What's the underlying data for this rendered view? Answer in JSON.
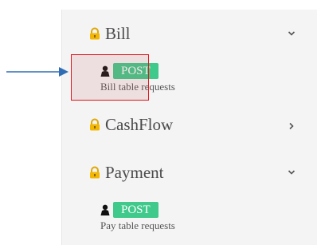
{
  "sections": [
    {
      "title": "Bill",
      "expanded": true,
      "endpoints": [
        {
          "method": "POST",
          "description": "Bill table requests"
        }
      ]
    },
    {
      "title": "CashFlow",
      "expanded": false,
      "endpoints": []
    },
    {
      "title": "Payment",
      "expanded": true,
      "endpoints": [
        {
          "method": "POST",
          "description": "Pay table requests"
        }
      ]
    }
  ],
  "colors": {
    "method_post": "#3fc98a",
    "lock_icon": "#f2b705",
    "highlight_border": "#e0161c",
    "arrow": "#2f6db5"
  },
  "icons": {
    "section": "lock-icon",
    "endpoint": "user-icon",
    "expanded": "chevron-down-icon",
    "collapsed": "chevron-right-icon",
    "pointer": "arrow-right-icon"
  }
}
